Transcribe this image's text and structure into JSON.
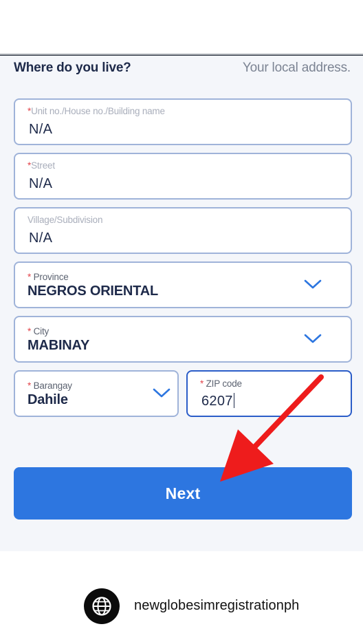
{
  "section": {
    "title": "Where do you live?",
    "subtitle": "Your local address."
  },
  "fields": {
    "unit": {
      "label": "Unit no./House no./Building name",
      "required_mark": "*",
      "value": "N/A"
    },
    "street": {
      "label": "Street",
      "required_mark": "*",
      "value": "N/A"
    },
    "village": {
      "label": "Village/Subdivision",
      "value": "N/A"
    },
    "province": {
      "label": "Province",
      "required_mark": "*",
      "value": "NEGROS ORIENTAL"
    },
    "city": {
      "label": "City",
      "required_mark": "*",
      "value": "MABINAY"
    },
    "barangay": {
      "label": "Barangay",
      "required_mark": "*",
      "value": "Dahile"
    },
    "zip": {
      "label": "ZIP code",
      "required_mark": "*",
      "value": "6207"
    }
  },
  "next_button": {
    "label": "Next"
  },
  "footer": {
    "icon": "globe-icon",
    "account": "newglobesimregistrationph"
  },
  "colors": {
    "accent": "#2d76e0",
    "field_border": "#9fb3d9",
    "focused_border": "#2a5cc8",
    "required": "#e2444a",
    "annotation_arrow": "#ee1c1c",
    "heading": "#1e2a4a"
  }
}
